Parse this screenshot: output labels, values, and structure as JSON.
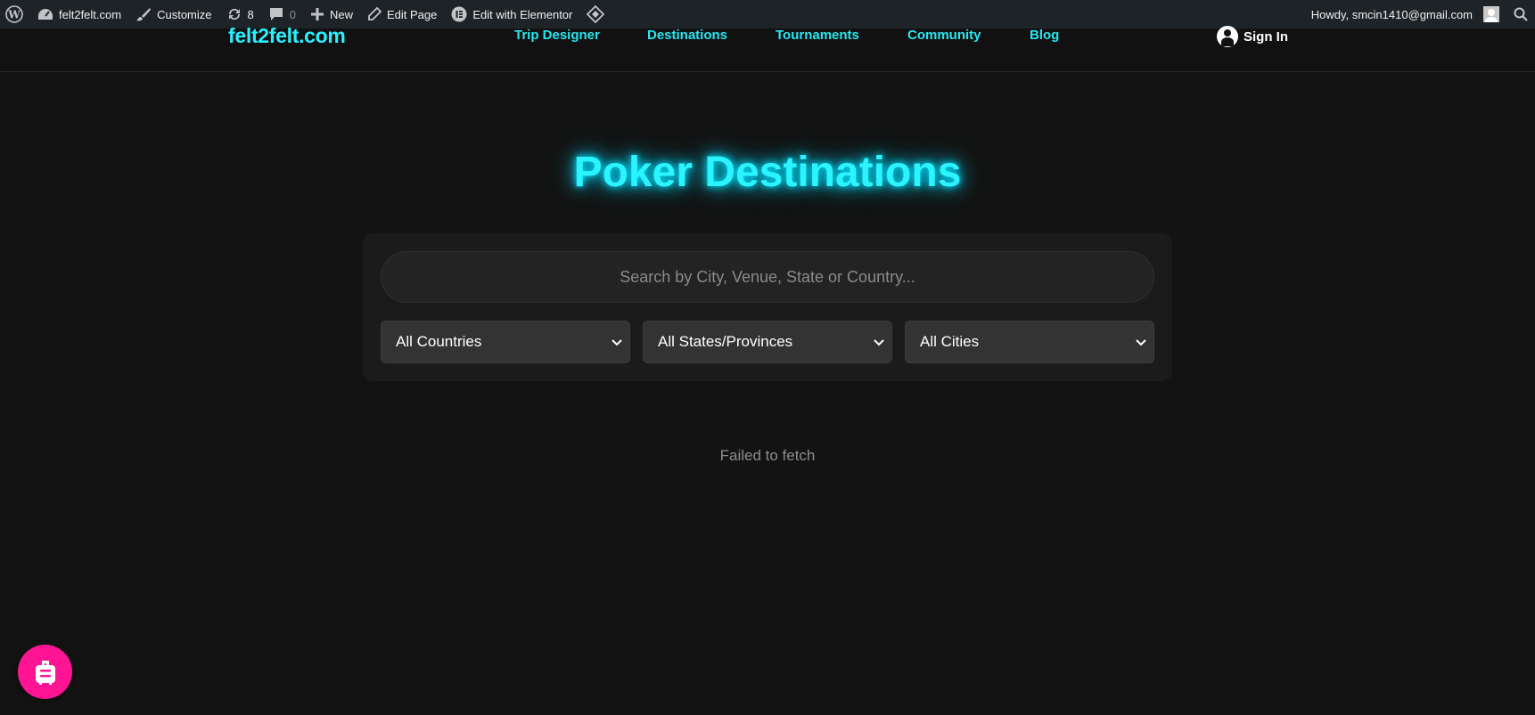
{
  "admin_bar": {
    "site_name": "felt2felt.com",
    "customize": "Customize",
    "updates_count": "8",
    "comments_count": "0",
    "new": "New",
    "edit_page": "Edit Page",
    "edit_elementor": "Edit with Elementor",
    "howdy": "Howdy, smcin1410@gmail.com"
  },
  "header": {
    "logo": "felt2felt.com",
    "nav": [
      "Trip Designer",
      "Destinations",
      "Tournaments",
      "Community",
      "Blog"
    ],
    "sign_in": "Sign In"
  },
  "main": {
    "title": "Poker Destinations",
    "search_placeholder": "Search by City, Venue, State or Country...",
    "filters": {
      "country": "All Countries",
      "state": "All States/Provinces",
      "city": "All Cities"
    },
    "status_message": "Failed to fetch"
  },
  "icons": [
    "wordpress-icon",
    "dashboard-icon",
    "brush-icon",
    "updates-icon",
    "comment-icon",
    "plus-icon",
    "pencil-icon",
    "elementor-icon",
    "diamond-icon",
    "search-icon",
    "user-icon",
    "chevron-down-icon",
    "luggage-icon"
  ],
  "colors": {
    "accent": "#29f0ff",
    "fab": "#ff1493",
    "background": "#131313"
  }
}
